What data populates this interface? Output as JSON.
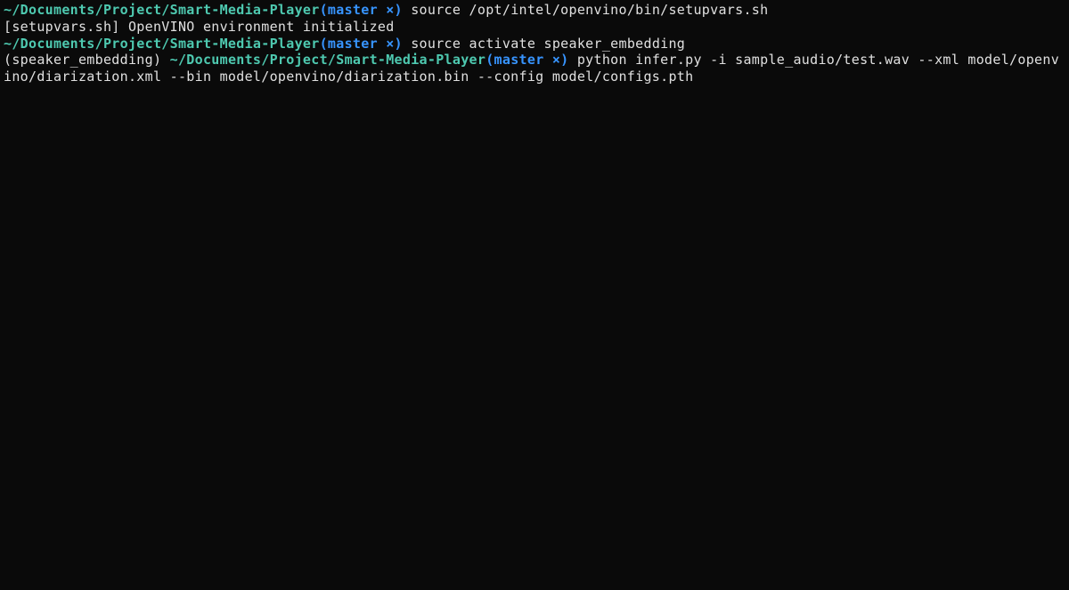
{
  "lines": [
    {
      "segments": [
        {
          "cls": "prompt-path",
          "text": "~/Documents/Project/Smart-Media-Player"
        },
        {
          "cls": "prompt-branch",
          "text": "(master ×)"
        },
        {
          "cls": "cmd-text",
          "text": " source /opt/intel/openvino/bin/setupvars.sh"
        }
      ]
    },
    {
      "segments": [
        {
          "cls": "output-text",
          "text": "[setupvars.sh] OpenVINO environment initialized"
        }
      ]
    },
    {
      "segments": [
        {
          "cls": "prompt-path",
          "text": "~/Documents/Project/Smart-Media-Player"
        },
        {
          "cls": "prompt-branch",
          "text": "(master ×)"
        },
        {
          "cls": "cmd-text",
          "text": " source activate speaker_embedding"
        }
      ]
    },
    {
      "segments": [
        {
          "cls": "env-prefix",
          "text": "(speaker_embedding) "
        },
        {
          "cls": "prompt-path",
          "text": "~/Documents/Project/Smart-Media-Player"
        },
        {
          "cls": "prompt-branch",
          "text": "(master ×)"
        },
        {
          "cls": "cmd-text",
          "text": " python infer.py -i sample_audio/test.wav --xml model/openvino/diarization.xml --bin model/openvino/diarization.bin --config model/configs.pth"
        }
      ]
    }
  ]
}
